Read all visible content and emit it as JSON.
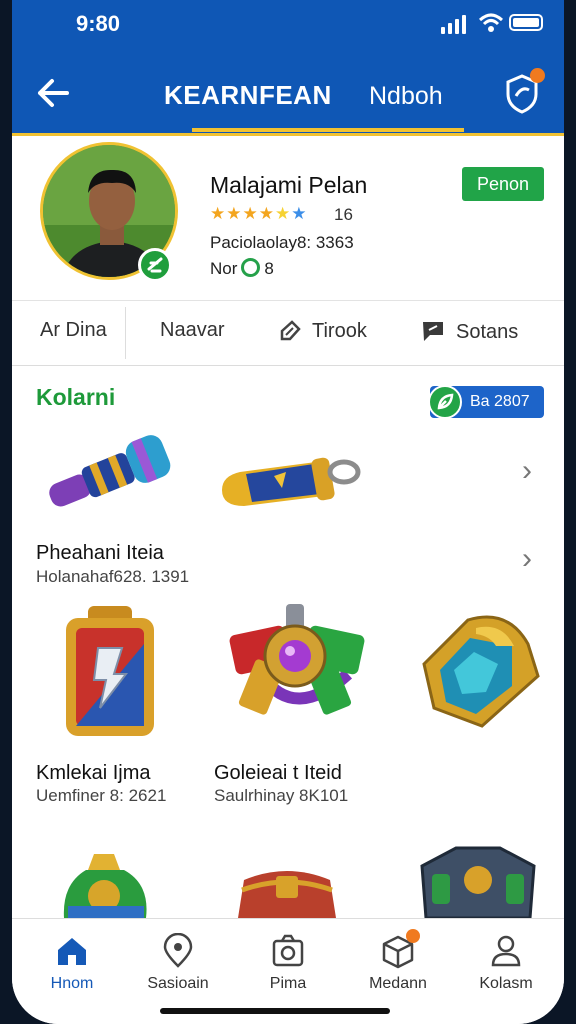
{
  "status": {
    "time": "9:80"
  },
  "header": {
    "title": "KEARNFEAN",
    "tab2": "Ndboh"
  },
  "profile": {
    "name": "Malajami Pelan",
    "rating": "16",
    "line1": "Paciolaolay8: 3363",
    "line2_prefix": "Nor",
    "line2_suffix": "8",
    "button": "Penon"
  },
  "subnav": [
    {
      "label": "Ar Dina"
    },
    {
      "label": "Naavar"
    },
    {
      "label": "Tirook"
    },
    {
      "label": "Sotans"
    }
  ],
  "section": {
    "title": "Kolarni",
    "pill": "Ba 2807"
  },
  "items": [
    {
      "title": "Pheahani Iteia",
      "sub": "Holanahaf628. 1391"
    },
    {
      "title": "Kmlekai Ijma",
      "sub": "Uemfiner 8: 2621"
    },
    {
      "title": "Goleieai t Iteid",
      "sub": "Saulrhinay 8K101"
    }
  ],
  "nav": [
    {
      "label": "Hnom"
    },
    {
      "label": "Sasioain"
    },
    {
      "label": "Pima"
    },
    {
      "label": "Medann"
    },
    {
      "label": "Kolasm"
    }
  ],
  "colors": {
    "header": "#0f57b5",
    "accent_green": "#21a448",
    "gold": "#f1c232"
  }
}
